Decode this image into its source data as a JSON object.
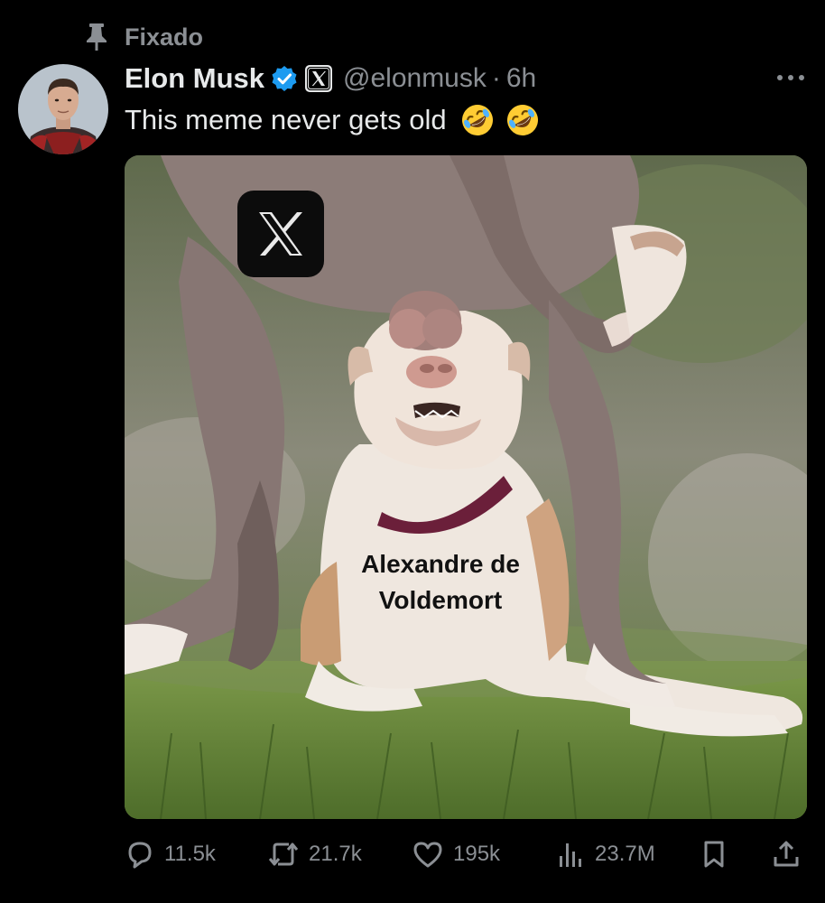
{
  "pinned": {
    "label": "Fixado",
    "icon": "pin-icon"
  },
  "author": {
    "name": "Elon Musk",
    "handle": "@elonmusk",
    "separator": "·",
    "time": "6h",
    "verified_color": "#1d9bf0"
  },
  "tweet": {
    "text": "This meme never gets old",
    "emojis": [
      "rolling-on-floor-laughing-emoji",
      "rolling-on-floor-laughing-emoji"
    ]
  },
  "media": {
    "caption_line1": "Alexandre de",
    "caption_line2": "Voldemort",
    "overlay_logo": "x-logo"
  },
  "actions": {
    "replies": "11.5k",
    "reposts": "21.7k",
    "likes": "195k",
    "views": "23.7M"
  },
  "colors": {
    "background": "#000000",
    "text_primary": "#e7e9ea",
    "text_secondary": "#8b8f94",
    "accent": "#1d9bf0"
  }
}
